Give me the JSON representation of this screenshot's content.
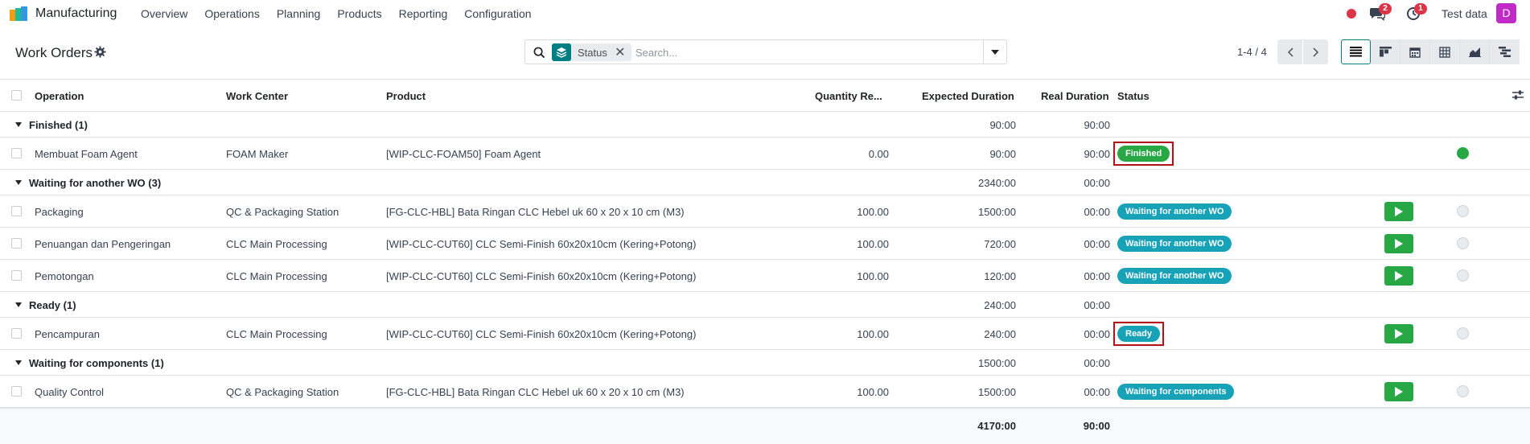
{
  "app": {
    "name": "Manufacturing",
    "brand_colors": [
      "#f39c12",
      "#1abc9c",
      "#3498db"
    ]
  },
  "menu": [
    "Overview",
    "Operations",
    "Planning",
    "Products",
    "Reporting",
    "Configuration"
  ],
  "systray": {
    "messages_count": "2",
    "activities_count": "1",
    "company": "Test data",
    "avatar_letter": "D"
  },
  "page": {
    "title": "Work Orders"
  },
  "search": {
    "facet_label": "Status",
    "placeholder": "Search..."
  },
  "pager": {
    "value": "1-4 / 4"
  },
  "views": [
    "list-view-icon",
    "kanban-view-icon",
    "calendar-view-icon",
    "pivot-view-icon",
    "graph-view-icon",
    "gantt-view-icon"
  ],
  "columns": {
    "operation": "Operation",
    "work_center": "Work Center",
    "product": "Product",
    "quantity": "Quantity Re...",
    "expected": "Expected Duration",
    "real": "Real Duration",
    "status": "Status"
  },
  "groups": [
    {
      "name": "Finished (1)",
      "expected": "90:00",
      "real": "90:00",
      "rows": [
        {
          "operation": "Membuat Foam Agent",
          "work_center": "FOAM Maker",
          "product": "[WIP-CLC-FOAM50] Foam Agent",
          "quantity": "0.00",
          "expected": "90:00",
          "real": "90:00",
          "status": "Finished",
          "status_color": "#28a745",
          "highlighted": true,
          "play": false,
          "state_color": "#28a745"
        }
      ]
    },
    {
      "name": "Waiting for another WO (3)",
      "expected": "2340:00",
      "real": "00:00",
      "rows": [
        {
          "operation": "Packaging",
          "work_center": "QC & Packaging Station",
          "product": "[FG-CLC-HBL] Bata Ringan CLC Hebel uk 60 x 20 x 10 cm (M3)",
          "quantity": "100.00",
          "expected": "1500:00",
          "real": "00:00",
          "status": "Waiting for another WO",
          "status_color": "#17a2b8",
          "highlighted": false,
          "play": true,
          "state_color": "#e9ecef"
        },
        {
          "operation": "Penuangan dan Pengeringan",
          "work_center": "CLC Main Processing",
          "product": "[WIP-CLC-CUT60] CLC Semi-Finish 60x20x10cm (Kering+Potong)",
          "quantity": "100.00",
          "expected": "720:00",
          "real": "00:00",
          "status": "Waiting for another WO",
          "status_color": "#17a2b8",
          "highlighted": false,
          "play": true,
          "state_color": "#e9ecef"
        },
        {
          "operation": "Pemotongan",
          "work_center": "CLC Main Processing",
          "product": "[WIP-CLC-CUT60] CLC Semi-Finish 60x20x10cm (Kering+Potong)",
          "quantity": "100.00",
          "expected": "120:00",
          "real": "00:00",
          "status": "Waiting for another WO",
          "status_color": "#17a2b8",
          "highlighted": false,
          "play": true,
          "state_color": "#e9ecef"
        }
      ]
    },
    {
      "name": "Ready (1)",
      "expected": "240:00",
      "real": "00:00",
      "rows": [
        {
          "operation": "Pencampuran",
          "work_center": "CLC Main Processing",
          "product": "[WIP-CLC-CUT60] CLC Semi-Finish 60x20x10cm (Kering+Potong)",
          "quantity": "100.00",
          "expected": "240:00",
          "real": "00:00",
          "status": "Ready",
          "status_color": "#17a2b8",
          "highlighted": true,
          "play": true,
          "state_color": "#e9ecef"
        }
      ]
    },
    {
      "name": "Waiting for components (1)",
      "expected": "1500:00",
      "real": "00:00",
      "rows": [
        {
          "operation": "Quality Control",
          "work_center": "QC & Packaging Station",
          "product": "[FG-CLC-HBL] Bata Ringan CLC Hebel uk 60 x 20 x 10 cm (M3)",
          "quantity": "100.00",
          "expected": "1500:00",
          "real": "00:00",
          "status": "Waiting for components",
          "status_color": "#17a2b8",
          "highlighted": false,
          "play": true,
          "state_color": "#e9ecef"
        }
      ]
    }
  ],
  "totals": {
    "expected": "4170:00",
    "real": "90:00"
  }
}
